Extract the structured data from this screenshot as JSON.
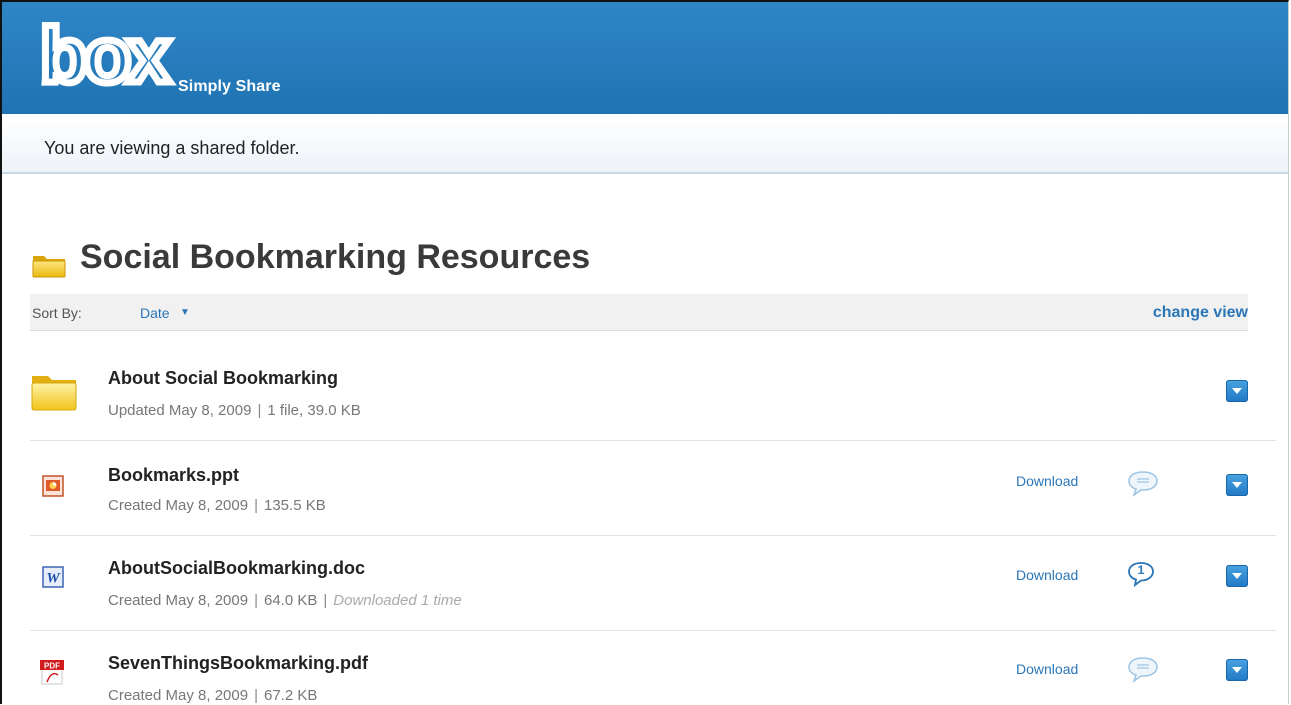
{
  "header": {
    "logo": "box",
    "tagline": "Simply Share",
    "colors": {
      "bar": "#2f86c6",
      "accent": "#2a76b8"
    }
  },
  "notice": {
    "text": "You are viewing a shared folder."
  },
  "folder": {
    "title": "Social Bookmarking Resources",
    "icon": "folder-icon"
  },
  "sortbar": {
    "label": "Sort By:",
    "value": "Date",
    "change_view": "change view"
  },
  "items": [
    {
      "name": "About Social Bookmarking",
      "meta": "Updated May 8, 2009",
      "sep": "|",
      "detail": "1 file,  39.0 KB",
      "extra": "",
      "icon": "folder-icon",
      "download": "",
      "comments": ""
    },
    {
      "name": "Bookmarks.ppt",
      "meta": "Created May 8, 2009",
      "sep": "|",
      "detail": "135.5 KB",
      "extra": "",
      "icon": "powerpoint-file-icon",
      "download": "Download",
      "comments": ""
    },
    {
      "name": "AboutSocialBookmarking.doc",
      "meta": "Created May 8, 2009",
      "sep": "|",
      "detail": "64.0 KB",
      "extra_sep": "|",
      "extra": "Downloaded 1 time",
      "icon": "word-file-icon",
      "download": "Download",
      "comments": "1"
    },
    {
      "name": "SevenThingsBookmarking.pdf",
      "meta": "Created May 8, 2009",
      "sep": "|",
      "detail": "67.2 KB",
      "extra": "",
      "icon": "pdf-file-icon",
      "download": "Download",
      "comments": ""
    }
  ]
}
